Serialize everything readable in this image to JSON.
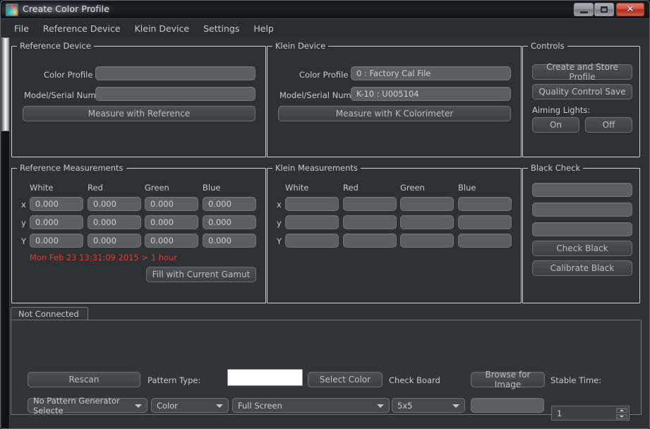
{
  "window": {
    "title": "Create Color Profile",
    "icon": "color-gamut-icon",
    "minimize_label": "–",
    "maximize_label": "",
    "close_label": "✕"
  },
  "menubar": {
    "items": [
      {
        "label": "File"
      },
      {
        "label": "Reference Device"
      },
      {
        "label": "Klein Device"
      },
      {
        "label": "Settings"
      },
      {
        "label": "Help"
      }
    ]
  },
  "reference_device": {
    "legend": "Reference Device",
    "color_profile_label": "Color Profile",
    "color_profile_value": "",
    "model_serial_label": "Model/Serial Number",
    "model_serial_value": "",
    "measure_button": "Measure with Reference"
  },
  "klein_device": {
    "legend": "Klein Device",
    "color_profile_label": "Color Profile",
    "color_profile_value": "0 : Factory Cal File",
    "model_serial_label": "Model/Serial Number",
    "model_serial_value": "K-10 : U005104",
    "measure_button": "Measure with K Colorimeter"
  },
  "controls": {
    "legend": "Controls",
    "create_store_button": "Create and Store Profile",
    "quality_control_button": "Quality Control Save",
    "aiming_lights_label": "Aiming Lights:",
    "on_button": "On",
    "off_button": "Off"
  },
  "reference_measurements": {
    "legend": "Reference Measurements",
    "columns": [
      "White",
      "Red",
      "Green",
      "Blue"
    ],
    "rows": [
      {
        "axis": "x",
        "values": [
          "0.000",
          "0.000",
          "0.000",
          "0.000"
        ]
      },
      {
        "axis": "y",
        "values": [
          "0.000",
          "0.000",
          "0.000",
          "0.000"
        ]
      },
      {
        "axis": "Y",
        "values": [
          "0.000",
          "0.000",
          "0.000",
          "0.000"
        ]
      }
    ],
    "timestamp": "Mon Feb 23 13:31:09 2015 > 1 hour",
    "timestamp_color": "#e03a2f",
    "fill_gamut_button": "Fill with Current Gamut"
  },
  "klein_measurements": {
    "legend": "Klein Measurements",
    "columns": [
      "White",
      "Red",
      "Green",
      "Blue"
    ],
    "rows": [
      {
        "axis": "x",
        "values": [
          "",
          "",
          "",
          ""
        ]
      },
      {
        "axis": "y",
        "values": [
          "",
          "",
          "",
          ""
        ]
      },
      {
        "axis": "Y",
        "values": [
          "",
          "",
          "",
          ""
        ]
      }
    ]
  },
  "black_check": {
    "legend": "Black Check",
    "readouts": [
      "",
      "",
      ""
    ],
    "check_black_button": "Check Black",
    "calibrate_black_button": "Calibrate Black"
  },
  "bottom_panel": {
    "tab_label": "Not Connected",
    "rescan_button": "Rescan",
    "pattern_type_label": "Pattern Type:",
    "pattern_color_swatch": "#ffffff",
    "select_color_button": "Select Color",
    "check_board_label": "Check Board",
    "browse_image_button": "Browse for Image",
    "stable_time_label": "Stable Time:",
    "generator_combo": "No Pattern Generator Selecte",
    "color_combo": "Color",
    "screen_combo": "Full Screen",
    "checkboard_combo": "5x5",
    "image_path_value": "",
    "stable_time_value": "1"
  }
}
